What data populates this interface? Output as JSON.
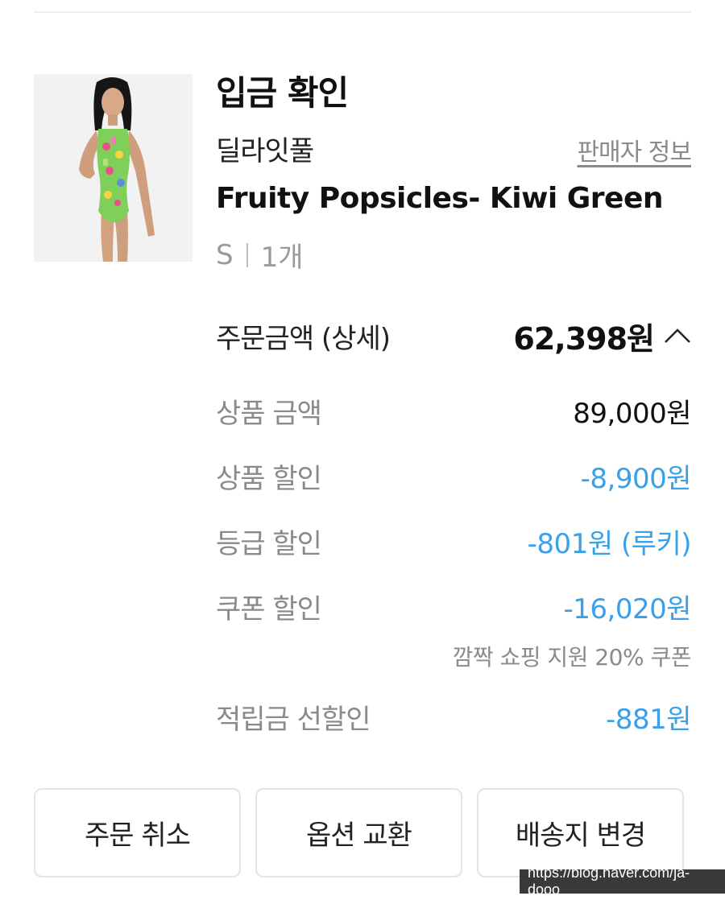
{
  "order": {
    "status_title": "입금 확인",
    "seller_name": "딜라잇풀",
    "seller_info_link": "판매자 정보",
    "product_name": "Fruity Popsicles- Kiwi Green",
    "option_size": "S",
    "option_quantity": "1개"
  },
  "order_total": {
    "label": "주문금액 (상세)",
    "value": "62,398원",
    "toggle_icon": "chevron-up-icon"
  },
  "breakdown": {
    "product_amount": {
      "label": "상품 금액",
      "value": "89,000원"
    },
    "product_discount": {
      "label": "상품 할인",
      "value": "-8,900원"
    },
    "grade_discount": {
      "label": "등급 할인",
      "value": "-801원 (루키)"
    },
    "coupon_discount": {
      "label": "쿠폰 할인",
      "value": "-16,020원",
      "note": "깜짝 쇼핑 지원 20% 쿠폰"
    },
    "points_discount": {
      "label": "적립금 선할인",
      "value": "-881원"
    }
  },
  "actions": {
    "cancel_order": "주문 취소",
    "exchange_option": "옵션 교환",
    "change_address": "배송지 변경"
  },
  "watermark": "https://blog.naver.com/ja-dooo",
  "colors": {
    "discount": "#3aa0e8",
    "muted": "#8a8a8a",
    "border": "#e3e3e3"
  }
}
